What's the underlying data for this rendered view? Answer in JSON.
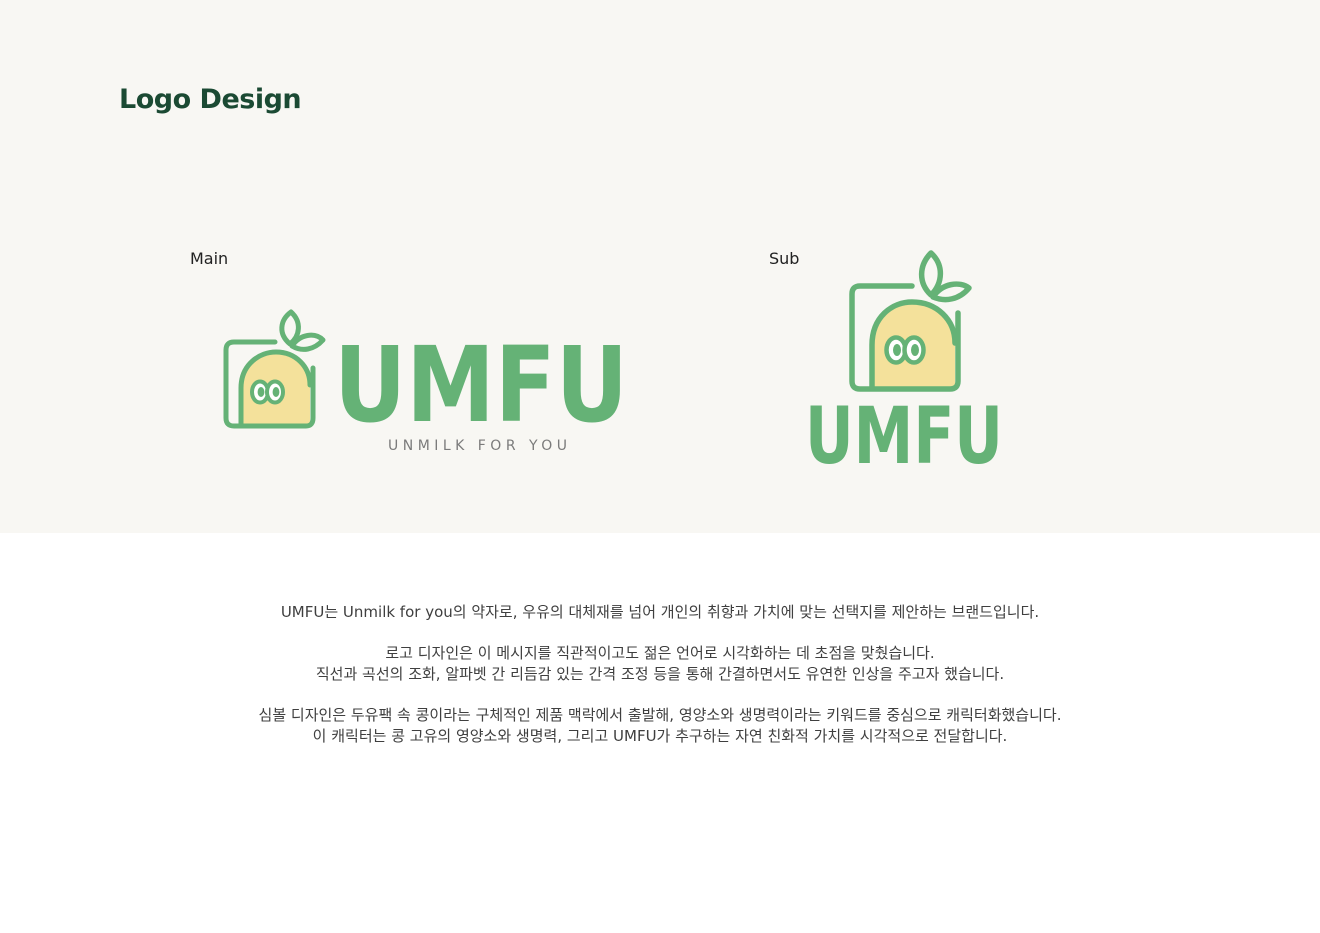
{
  "page": {
    "title": "Logo Design",
    "background_top": "#f8f7f3",
    "background_bottom": "#ffffff"
  },
  "colors": {
    "brand_green": "#65b276",
    "bean_yellow": "#f4e19b",
    "title_green": "#1b4a33"
  },
  "main_logo": {
    "label": "Main",
    "wordmark": "UMFU",
    "tagline": "UNMILK FOR YOU"
  },
  "sub_logo": {
    "label": "Sub",
    "wordmark": "UMFU"
  },
  "description": {
    "p1": "UMFU는 Unmilk for you의 약자로, 우유의 대체재를 넘어 개인의 취향과 가치에 맞는 선택지를 제안하는 브랜드입니다.",
    "p2_line1": "로고 디자인은 이 메시지를 직관적이고도 젊은 언어로 시각화하는 데 초점을 맞췄습니다.",
    "p2_line2": "직선과 곡선의 조화, 알파벳 간 리듬감 있는 간격 조정 등을 통해 간결하면서도 유연한 인상을 주고자 했습니다.",
    "p3_line1": "심볼 디자인은 두유팩 속 콩이라는 구체적인 제품 맥락에서 출발해, 영양소와 생명력이라는 키워드를 중심으로 캐릭터화했습니다.",
    "p3_line2": "이 캐릭터는 콩 고유의 영양소와 생명력, 그리고 UMFU가 추구하는 자연 친화적 가치를 시각적으로 전달합니다."
  }
}
